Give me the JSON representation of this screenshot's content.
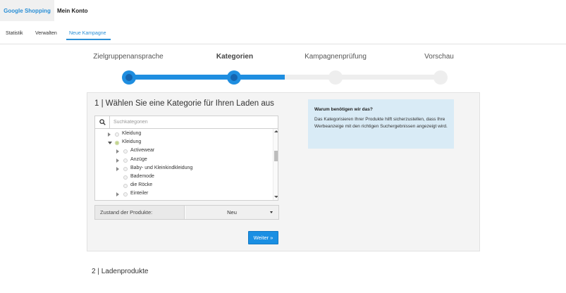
{
  "header": {
    "brand": "Google Shopping",
    "account": "Mein Konto"
  },
  "tabs": [
    {
      "label": "Statistik",
      "active": false
    },
    {
      "label": "Verwalten",
      "active": false
    },
    {
      "label": "Neue Kampagne",
      "active": true
    }
  ],
  "stepper": {
    "steps": [
      {
        "label": "Zielgruppenansprache",
        "done": true,
        "current": false
      },
      {
        "label": "Kategorien",
        "done": true,
        "current": true
      },
      {
        "label": "Kampagnenprüfung",
        "done": false,
        "current": false
      },
      {
        "label": "Vorschau",
        "done": false,
        "current": false
      }
    ],
    "progress": 0.5
  },
  "category_panel": {
    "title": "1 | Wählen Sie eine Kategorie für Ihren Laden aus",
    "search": {
      "placeholder": "Suchkategorien",
      "value": "",
      "icon": "search-icon"
    },
    "tree": [
      {
        "label": "Kleidung",
        "level": 0,
        "expander": "collapsed",
        "checked": false
      },
      {
        "label": "Kleidung",
        "level": 0,
        "expander": "expanded",
        "checked": true
      },
      {
        "label": "Activewear",
        "level": 1,
        "expander": "collapsed",
        "checked": false
      },
      {
        "label": "Anzüge",
        "level": 1,
        "expander": "collapsed",
        "checked": false
      },
      {
        "label": "Baby- und Kleinkindkleidung",
        "level": 1,
        "expander": "collapsed",
        "checked": false
      },
      {
        "label": "Bademode",
        "level": 1,
        "expander": "none",
        "checked": false
      },
      {
        "label": "die Röcke",
        "level": 1,
        "expander": "none",
        "checked": false
      },
      {
        "label": "Einteiler",
        "level": 1,
        "expander": "collapsed",
        "checked": false
      }
    ],
    "condition": {
      "label": "Zustand der Produkte:",
      "value": "Neu"
    },
    "next_button": "Weiter »"
  },
  "info_box": {
    "title": "Warum benötigen wir das?",
    "text": "Das Kategorisieren Ihrer Produkte hilft sicherzustellen, dass Ihre Werbeanzeige mit den richtigen Suchergebnissen angezeigt wird."
  },
  "next_section": {
    "title": "2 | Ladenprodukte"
  },
  "colors": {
    "accent": "#1f8ee0",
    "info_bg": "#d9ebf6",
    "panel_bg": "#f4f4f4"
  }
}
